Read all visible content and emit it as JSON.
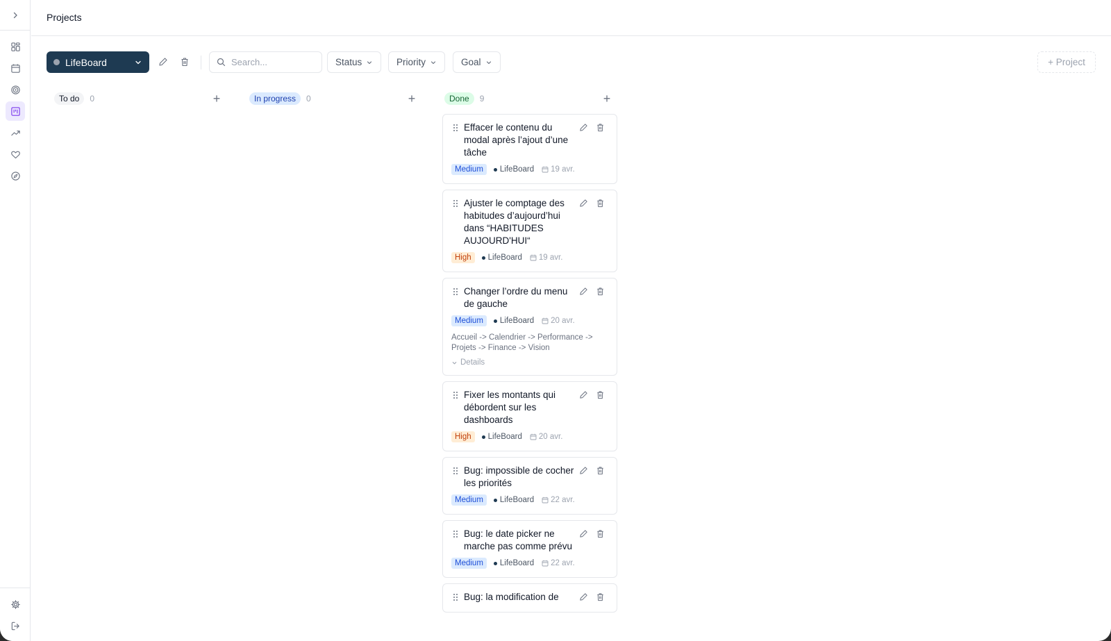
{
  "header": {
    "title": "Projects"
  },
  "sidebar": {
    "items": [
      {
        "icon": "dashboard-icon"
      },
      {
        "icon": "calendar-icon"
      },
      {
        "icon": "target-icon"
      },
      {
        "icon": "kanban-icon",
        "active": true
      },
      {
        "icon": "trending-up-icon"
      },
      {
        "icon": "heart-icon"
      },
      {
        "icon": "compass-icon"
      }
    ],
    "bottom": [
      {
        "icon": "gear-icon"
      },
      {
        "icon": "logout-icon"
      }
    ]
  },
  "toolbar": {
    "project_name": "LifeBoard",
    "search_placeholder": "Search...",
    "filters": {
      "status": "Status",
      "priority": "Priority",
      "goal": "Goal"
    },
    "add_project": "+ Project"
  },
  "columns": [
    {
      "label": "To do",
      "count": "0",
      "bg": "#f3f4f6",
      "fg": "#111827"
    },
    {
      "label": "In progress",
      "count": "0",
      "bg": "#dbeafe",
      "fg": "#1e40af"
    },
    {
      "label": "Done",
      "count": "9",
      "bg": "#dcfce7",
      "fg": "#166534"
    }
  ],
  "cards": [
    {
      "title": "Effacer le contenu du modal après l’ajout d’une tâche",
      "priority": "Medium",
      "project": "LifeBoard",
      "date": "19 avr."
    },
    {
      "title": "Ajuster le comptage des habitudes d’aujourd’hui dans “HABITUDES AUJOURD'HUI“",
      "priority": "High",
      "project": "LifeBoard",
      "date": "19 avr."
    },
    {
      "title": "Changer l’ordre du menu de gauche",
      "priority": "Medium",
      "project": "LifeBoard",
      "date": "20 avr.",
      "description": "Accueil -> Calendrier -> Performance -> Projets -> Finance -> Vision",
      "details": "Details"
    },
    {
      "title": "Fixer les montants qui débordent sur les dashboards",
      "priority": "High",
      "project": "LifeBoard",
      "date": "20 avr."
    },
    {
      "title": "Bug: impossible de cocher les priorités",
      "priority": "Medium",
      "project": "LifeBoard",
      "date": "22 avr."
    },
    {
      "title": "Bug: le date picker ne marche pas comme prévu",
      "priority": "Medium",
      "project": "LifeBoard",
      "date": "22 avr."
    },
    {
      "title": "Bug: la modification de",
      "priority": "",
      "project": "",
      "date": ""
    }
  ],
  "colors": {
    "accent": "#1e3a52",
    "sidebar_active": "#ede9fe"
  }
}
